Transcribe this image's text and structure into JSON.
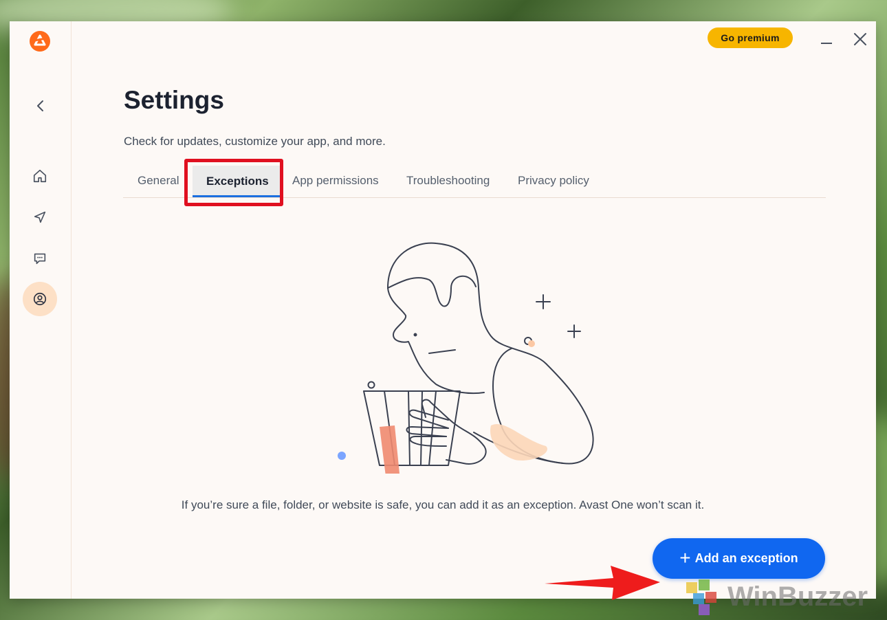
{
  "window": {
    "title": "Settings",
    "subtitle": "Check for updates, customize your app, and more.",
    "premium_label": "Go premium"
  },
  "sidebar": {
    "items": [
      {
        "name": "home",
        "icon": "home-icon"
      },
      {
        "name": "explore",
        "icon": "navigation-arrow-icon"
      },
      {
        "name": "chat",
        "icon": "chat-bubble-icon"
      },
      {
        "name": "account",
        "icon": "account-icon",
        "active": true
      }
    ]
  },
  "tabs": [
    {
      "label": "General",
      "active": false
    },
    {
      "label": "Exceptions",
      "active": true
    },
    {
      "label": "App permissions",
      "active": false
    },
    {
      "label": "Troubleshooting",
      "active": false
    },
    {
      "label": "Privacy policy",
      "active": false
    }
  ],
  "main": {
    "info": "If you’re sure a file, folder, or website is safe, you can add it as an exception. Avast One won’t scan it.",
    "add_button_label": "Add an exception",
    "add_button_icon": "+"
  },
  "watermark": {
    "text": "WinBuzzer"
  },
  "colors": {
    "accent": "#1067f0",
    "premium": "#f7b500",
    "highlight": "#e01020",
    "brand": "#ff6a1a"
  }
}
